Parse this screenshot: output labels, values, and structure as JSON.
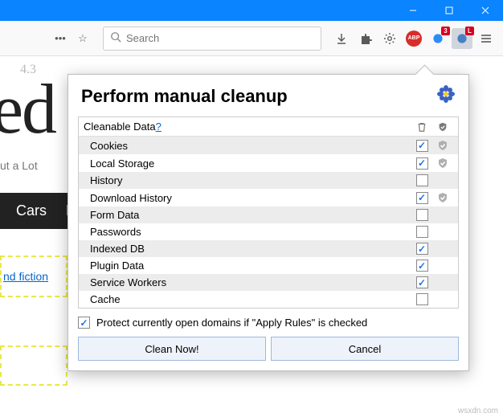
{
  "titlebar": {
    "min": "—",
    "max": "❐",
    "close": "✕"
  },
  "toolbar": {
    "search_placeholder": "Search",
    "badge_3": "3",
    "badge_l": "L"
  },
  "page": {
    "version": "4.3",
    "big": "ed",
    "subtitle": "ut a Lot",
    "tab_cars": "Cars",
    "tab_f": "F",
    "link": "nd fiction"
  },
  "popup": {
    "title": "Perform manual cleanup",
    "th_label": "Cleanable Data",
    "th_q": "?",
    "items": [
      {
        "label": "Cookies",
        "clean": true,
        "shield": true
      },
      {
        "label": "Local Storage",
        "clean": true,
        "shield": true
      },
      {
        "label": "History",
        "clean": false,
        "shield": false
      },
      {
        "label": "Download History",
        "clean": true,
        "shield": true
      },
      {
        "label": "Form Data",
        "clean": false,
        "shield": false
      },
      {
        "label": "Passwords",
        "clean": false,
        "shield": false
      },
      {
        "label": "Indexed DB",
        "clean": true,
        "shield": false
      },
      {
        "label": "Plugin Data",
        "clean": true,
        "shield": false
      },
      {
        "label": "Service Workers",
        "clean": true,
        "shield": false
      },
      {
        "label": "Cache",
        "clean": false,
        "shield": false
      }
    ],
    "protect": "Protect currently open domains if \"Apply Rules\" is checked",
    "clean_btn": "Clean Now!",
    "cancel_btn": "Cancel"
  },
  "watermark": "wsxdn.com"
}
